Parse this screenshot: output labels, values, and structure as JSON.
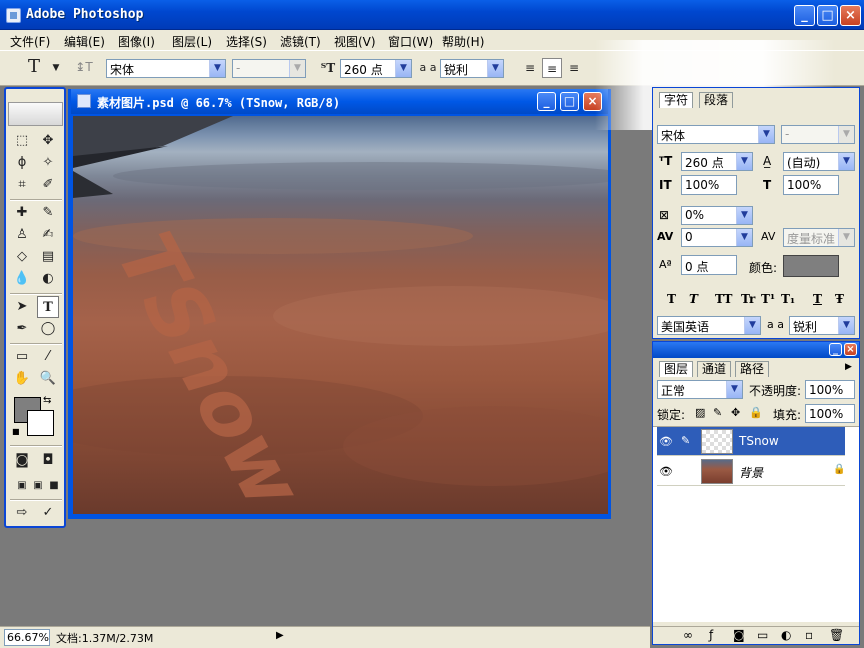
{
  "app": {
    "title": "Adobe Photoshop"
  },
  "window_controls": {
    "minimize": "_",
    "maximize": "□",
    "close": "×"
  },
  "menu": [
    "文件(F)",
    "编辑(E)",
    "图像(I)",
    "图层(L)",
    "选择(S)",
    "滤镜(T)",
    "视图(V)",
    "窗口(W)",
    "帮助(H)"
  ],
  "options": {
    "tool_glyph": "T",
    "font_family": "宋体",
    "font_style": "-",
    "size": "260 点",
    "aa_label": "a a",
    "antialias": "锐利"
  },
  "document": {
    "title": "素材图片.psd @ 66.7% (TSnow, RGB/8)",
    "text_layer_content": "TSnow"
  },
  "character": {
    "tab_char": "字符",
    "tab_para": "段落",
    "font_family": "宋体",
    "font_style": "-",
    "size": "260 点",
    "leading": "(自动)",
    "vscale": "100%",
    "hscale": "100%",
    "tsume": "0%",
    "kerning": "0",
    "tracking": "度量标准",
    "baseline": "0 点",
    "color_label": "颜色:",
    "color": "#7f7f7f",
    "language": "美国英语",
    "antialias": "锐利",
    "aa_label": "a a",
    "format_buttons": [
      "T",
      "T",
      "TT",
      "Tr",
      "T¹",
      "T₁",
      "T",
      "Ŧ"
    ]
  },
  "layers": {
    "tabs": [
      "图层",
      "通道",
      "路径"
    ],
    "blend_mode": "正常",
    "opacity_label": "不透明度:",
    "opacity": "100%",
    "lock_label": "锁定:",
    "fill_label": "填充:",
    "fill": "100%",
    "items": [
      {
        "name": "TSnow",
        "selected": true
      },
      {
        "name": "背景",
        "selected": false
      }
    ]
  },
  "status": {
    "zoom": "66.67%",
    "doc_info": "文档:1.37M/2.73M"
  },
  "colors": {
    "titlebar": "#0054e3",
    "panel_bg": "#ece9d8",
    "workspace": "#7a7a7a",
    "foreground": "#7f7f7f",
    "background": "#ffffff",
    "text_layer": "#b46446"
  }
}
